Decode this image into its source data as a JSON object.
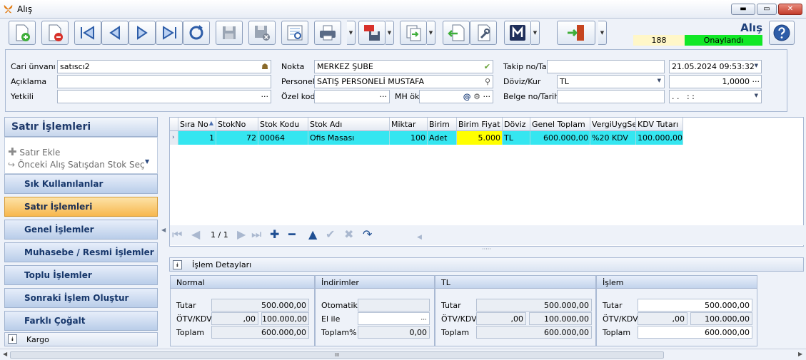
{
  "window": {
    "title": "Alış",
    "controls": {
      "minimize": "▬",
      "maximize": "▭",
      "close": "✕"
    }
  },
  "toolbar": {
    "doc_title": "Alış",
    "record_no": "188",
    "status": "Onaylandı",
    "status_color": "#11e826",
    "buttons": [
      "new-document",
      "delete-document",
      "first-record",
      "previous-record",
      "next-record",
      "last-record",
      "refresh",
      "save",
      "save-close",
      "preview",
      "print",
      "pdf-export",
      "copy-export",
      "import",
      "tools",
      "m-module",
      "exit",
      "help"
    ]
  },
  "form": {
    "cari_unvani": {
      "label": "Cari ünvanı",
      "value": "satıscı2"
    },
    "aciklama": {
      "label": "Açıklama",
      "value": ""
    },
    "yetkili": {
      "label": "Yetkili",
      "value": ""
    },
    "nokta": {
      "label": "Nokta",
      "value": "MERKEZ ŞUBE"
    },
    "personel": {
      "label": "Personel",
      "value": "SATIŞ PERSONELİ MUSTAFA"
    },
    "ozel_kod": {
      "label": "Özel kod",
      "value": ""
    },
    "mh_ok": {
      "label": "MH ök",
      "value": ""
    },
    "takip_no": {
      "label": "Takip no/Tarih",
      "value": "",
      "date": "21.05.2024 09:53:32"
    },
    "doviz_kur": {
      "label": "Döviz/Kur",
      "currency": "TL",
      "rate": "1,0000"
    },
    "belge_no": {
      "label": "Belge no/Tarih",
      "value": "",
      "date": ". .   : :"
    }
  },
  "left_panel": {
    "header": "Satır İşlemleri",
    "tasks": [
      {
        "label": "Satır Ekle"
      },
      {
        "label": "Önceki Alış Satışdan Stok Seç"
      }
    ],
    "groups": [
      {
        "label": "Sık Kullanılanlar",
        "active": false
      },
      {
        "label": "Satır İşlemleri",
        "active": true
      },
      {
        "label": "Genel İşlemler",
        "active": false
      },
      {
        "label": "Muhasebe / Resmi İşlemler",
        "active": false
      },
      {
        "label": "Toplu İşlemler",
        "active": false
      },
      {
        "label": "Sonraki İşlem Oluştur",
        "active": false
      },
      {
        "label": "Farklı Çoğalt",
        "active": false
      }
    ],
    "footer": "Kargo"
  },
  "grid": {
    "columns": [
      "Sıra No",
      "StokNo",
      "Stok Kodu",
      "Stok Adı",
      "Miktar",
      "Birim",
      "Birim Fiyat",
      "Döviz",
      "Genel Toplam",
      "VergiUygSet",
      "KDV Tutarı"
    ],
    "rows": [
      [
        "1",
        "72",
        "00064",
        "Ofis Masası",
        "100",
        "Adet",
        "5.000",
        "TL",
        "600.000,00",
        "%20 KDV",
        "100.000,00"
      ]
    ],
    "row_color": "#35e6f0",
    "highlight_color": "#ffff00",
    "pager": "1 / 1"
  },
  "details": {
    "title": "İşlem Detayları",
    "normal": {
      "title": "Normal",
      "tutar_label": "Tutar",
      "tutar": "500.000,00",
      "otv_label": "ÖTV/KDV",
      "otv": ",00",
      "kdv": "100.000,00",
      "toplam_label": "Toplam",
      "toplam": "600.000,00"
    },
    "indirimler": {
      "title": "İndirimler",
      "otomatik_label": "Otomatik",
      "otomatik": "",
      "elile_label": "El ile",
      "elile": "",
      "toplam_label": "Toplam%",
      "toplam": "0,00"
    },
    "tl": {
      "title": "TL",
      "tutar_label": "Tutar",
      "tutar": "500.000,00",
      "otv_label": "ÖTV/KDV",
      "otv": ",00",
      "kdv": "100.000,00",
      "toplam_label": "Toplam",
      "toplam": "600.000,00"
    },
    "islem": {
      "title": "İşlem",
      "tutar_label": "Tutar",
      "tutar": "500.000,00",
      "otv_label": "ÖTV/KDV",
      "otv": ",00",
      "kdv": "100.000,00",
      "toplam_label": "Toplam",
      "toplam": "600.000,00"
    }
  },
  "scroll": {
    "thumb": "III"
  }
}
